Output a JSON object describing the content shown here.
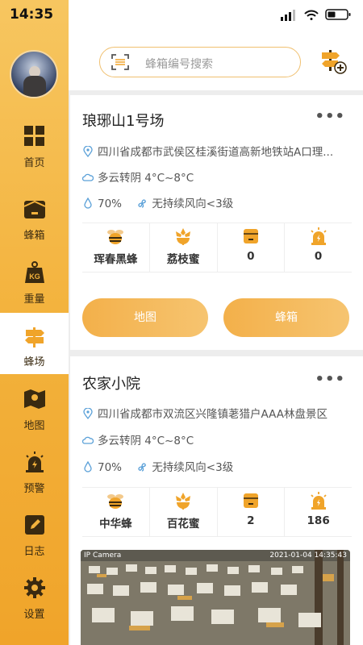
{
  "status": {
    "time": "14:35"
  },
  "sidebar": {
    "items": [
      {
        "label": "首页",
        "icon": "grid-icon"
      },
      {
        "label": "蜂箱",
        "icon": "beehive-box-icon"
      },
      {
        "label": "重量",
        "icon": "weight-kg-icon"
      },
      {
        "label": "蜂场",
        "icon": "apiary-signpost-icon"
      },
      {
        "label": "地图",
        "icon": "map-icon"
      },
      {
        "label": "预警",
        "icon": "alarm-icon"
      },
      {
        "label": "日志",
        "icon": "log-edit-icon"
      },
      {
        "label": "设置",
        "icon": "gear-icon"
      }
    ],
    "active": "蜂场"
  },
  "search": {
    "placeholder": "蜂箱编号搜索"
  },
  "apiaries": [
    {
      "name": "琅琊山1号场",
      "address": "四川省成都市武侯区桂溪街道高新地铁站A口理...",
      "weather": "多云转阴 4°C~8°C",
      "humidity": "70%",
      "wind": "无持续风向<3级",
      "stats": [
        "珲春黑蜂",
        "荔枝蜜",
        "0",
        "0"
      ],
      "map_button": "地图",
      "hive_button": "蜂箱"
    },
    {
      "name": "农家小院",
      "address": "四川省成都市双流区兴隆镇荖猎户AAA林盘景区",
      "weather": "多云转阴 4°C~8°C",
      "humidity": "70%",
      "wind": "无持续风向<3级",
      "stats": [
        "中华蜂",
        "百花蜜",
        "2",
        "186"
      ],
      "camera_label": "IP Camera",
      "camera_time": "2021-01-04 14:35:43"
    }
  ],
  "colors": {
    "accent": "#f3b04a",
    "sidebar": "#f3b23c"
  }
}
